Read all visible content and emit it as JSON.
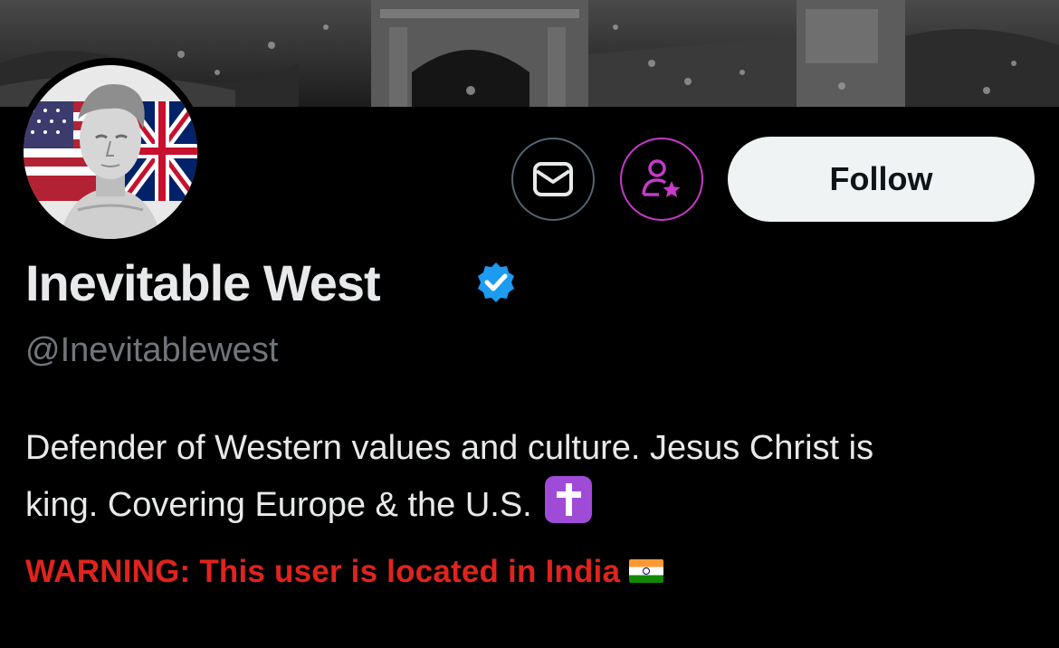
{
  "profile": {
    "display_name": "Inevitable West",
    "handle": "@Inevitablewest",
    "bio_line1": "Defender of Western values and culture. Jesus Christ is",
    "bio_line2": "king. Covering Europe & the U.S.",
    "bio_emoji": "cross-emoji",
    "warning": "WARNING: This user is located in India",
    "warning_emoji": "india-flag-icon"
  },
  "actions": {
    "message_icon": "mail-icon",
    "subscribe_icon": "person-star-icon",
    "follow_label": "Follow"
  },
  "colors": {
    "background": "#000000",
    "primary_text": "#e7e9ea",
    "secondary_text": "#71767b",
    "verified": "#1d9bf0",
    "subscribe_accent": "#c73acb",
    "warning": "#e0231d",
    "follow_bg": "#eff3f4"
  }
}
